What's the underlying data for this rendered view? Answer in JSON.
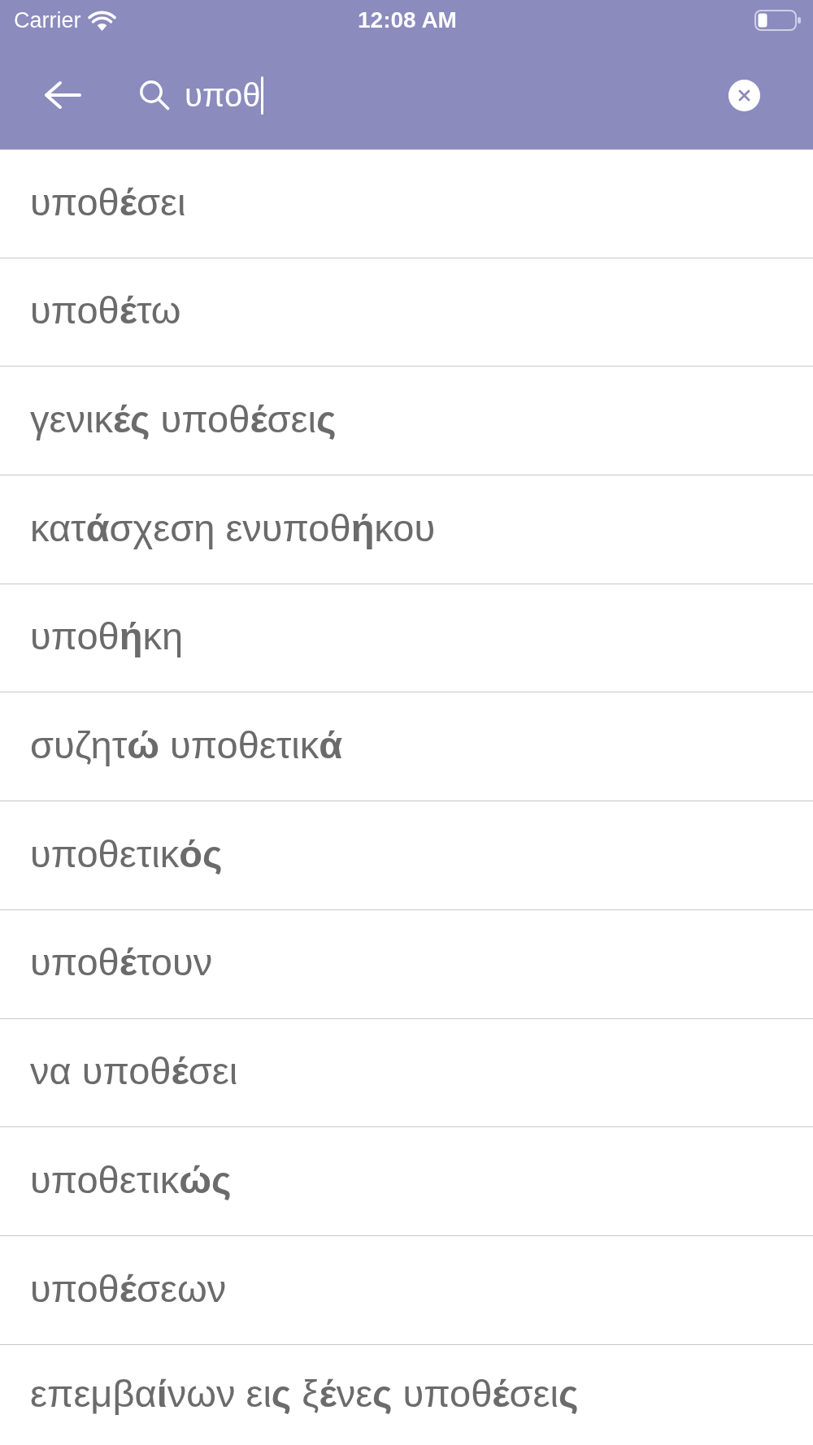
{
  "status_bar": {
    "carrier": "Carrier",
    "time": "12:08 AM"
  },
  "search": {
    "value": "υποθ",
    "focused": true
  },
  "results": [
    {
      "text": "υποθ**έ**σει"
    },
    {
      "text": "υποθ**έ**τω"
    },
    {
      "text": "γενικ**ές** υποθ**έ**σει**ς**"
    },
    {
      "text": "κατ**ά**σχεση ενυποθ**ή**κου"
    },
    {
      "text": "υποθ**ή**κη"
    },
    {
      "text": "συζητ**ώ** υποθετικ**ά**"
    },
    {
      "text": "υποθετικ**ός**"
    },
    {
      "text": "υποθ**έ**τουν"
    },
    {
      "text": "να υποθ**έ**σει"
    },
    {
      "text": "υποθετικ**ώς**"
    },
    {
      "text": "υποθ**έ**σεων"
    },
    {
      "text": "επεμβα**ί**νων ει**ς** ξ**έ**νε**ς** υποθ**έ**σει**ς**"
    }
  ]
}
